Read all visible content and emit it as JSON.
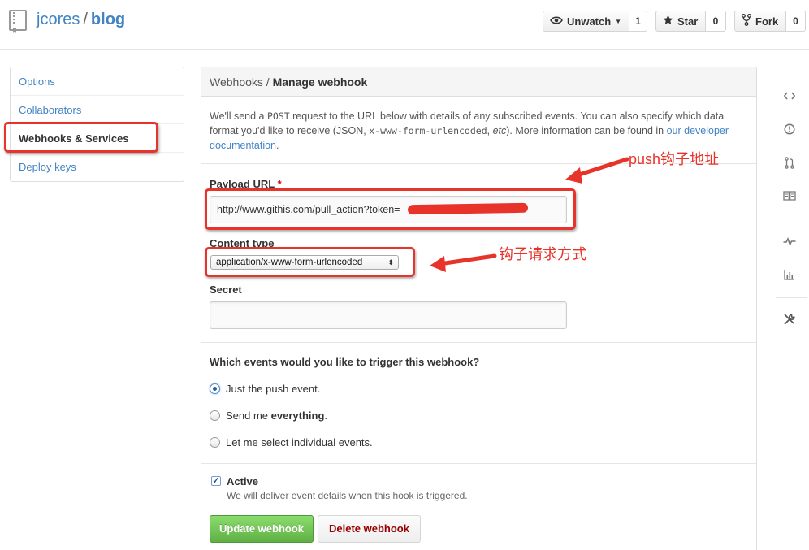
{
  "header": {
    "owner": "jcores",
    "separator": "/",
    "repo": "blog",
    "watch": {
      "label": "Unwatch",
      "count": "1"
    },
    "star": {
      "label": "Star",
      "count": "0"
    },
    "fork": {
      "label": "Fork",
      "count": "0"
    }
  },
  "sidebar": {
    "items": [
      {
        "label": "Options"
      },
      {
        "label": "Collaborators"
      },
      {
        "label": "Webhooks & Services"
      },
      {
        "label": "Deploy keys"
      }
    ]
  },
  "panel": {
    "breadcrumb_parent": "Webhooks",
    "breadcrumb_sep": "/",
    "title": "Manage webhook",
    "intro": {
      "p1": "We'll send a ",
      "code1": "POST",
      "p2": " request to the URL below with details of any subscribed events. You can also specify which data format you'd like to receive (JSON, ",
      "code2": "x-www-form-urlencoded",
      "p3": ", ",
      "etc": "etc",
      "p4": "). More information can be found in ",
      "link": "our developer documentation",
      "p5": "."
    },
    "payload_label": "Payload URL",
    "payload_required": "*",
    "payload_value": "http://www.githis.com/pull_action?token=",
    "content_type_label": "Content type",
    "content_type_value": "application/x-www-form-urlencoded",
    "secret_label": "Secret",
    "secret_value": "",
    "events_question": "Which events would you like to trigger this webhook?",
    "events": {
      "push_pre": "Just the ",
      "push_code": "push",
      "push_post": " event.",
      "everything_pre": "Send me ",
      "everything_bold": "everything",
      "everything_post": ".",
      "individual": "Let me select individual events."
    },
    "active_label": "Active",
    "active_note": "We will deliver event details when this hook is triggered.",
    "update_button": "Update webhook",
    "delete_button": "Delete webhook"
  },
  "annotations": {
    "push_hook": "push钩子地址",
    "request_method": "钩子请求方式"
  },
  "colors": {
    "link": "#4183c4",
    "annotation": "#e8332a",
    "success": "#60b044",
    "danger_text": "#990000"
  }
}
